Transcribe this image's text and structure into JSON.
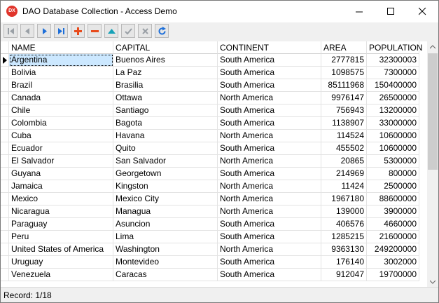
{
  "window": {
    "title": "DAO Database Collection - Access Demo",
    "icon_text": "DX"
  },
  "toolbar": {
    "buttons": [
      {
        "name": "first-record-icon"
      },
      {
        "name": "prior-record-icon"
      },
      {
        "name": "next-record-icon"
      },
      {
        "name": "last-record-icon"
      },
      {
        "name": "insert-record-icon"
      },
      {
        "name": "delete-record-icon"
      },
      {
        "name": "edit-record-icon"
      },
      {
        "name": "post-edit-icon"
      },
      {
        "name": "cancel-edit-icon"
      },
      {
        "name": "refresh-icon"
      }
    ]
  },
  "grid": {
    "columns": [
      "NAME",
      "CAPITAL",
      "CONTINENT",
      "AREA",
      "POPULATION"
    ],
    "rows": [
      [
        "Argentina",
        "Buenos Aires",
        "South America",
        "2777815",
        "32300003"
      ],
      [
        "Bolivia",
        "La Paz",
        "South America",
        "1098575",
        "7300000"
      ],
      [
        "Brazil",
        "Brasilia",
        "South America",
        "85111968",
        "150400000"
      ],
      [
        "Canada",
        "Ottawa",
        "North America",
        "9976147",
        "26500000"
      ],
      [
        "Chile",
        "Santiago",
        "South America",
        "756943",
        "13200000"
      ],
      [
        "Colombia",
        "Bagota",
        "South America",
        "1138907",
        "33000000"
      ],
      [
        "Cuba",
        "Havana",
        "North America",
        "114524",
        "10600000"
      ],
      [
        "Ecuador",
        "Quito",
        "South America",
        "455502",
        "10600000"
      ],
      [
        "El Salvador",
        "San Salvador",
        "North America",
        "20865",
        "5300000"
      ],
      [
        "Guyana",
        "Georgetown",
        "South America",
        "214969",
        "800000"
      ],
      [
        "Jamaica",
        "Kingston",
        "North America",
        "11424",
        "2500000"
      ],
      [
        "Mexico",
        "Mexico City",
        "North America",
        "1967180",
        "88600000"
      ],
      [
        "Nicaragua",
        "Managua",
        "North America",
        "139000",
        "3900000"
      ],
      [
        "Paraguay",
        "Asuncion",
        "South America",
        "406576",
        "4660000"
      ],
      [
        "Peru",
        "Lima",
        "South America",
        "1285215",
        "21600000"
      ],
      [
        "United States of America",
        "Washington",
        "North America",
        "9363130",
        "249200000"
      ],
      [
        "Uruguay",
        "Montevideo",
        "South America",
        "176140",
        "3002000"
      ],
      [
        "Venezuela",
        "Caracas",
        "South America",
        "912047",
        "19700000"
      ]
    ],
    "selected_row": 0
  },
  "status": {
    "text": "Record: 1/18"
  },
  "colors": {
    "selection": "#cce8ff",
    "app_icon": "#e0342b"
  }
}
